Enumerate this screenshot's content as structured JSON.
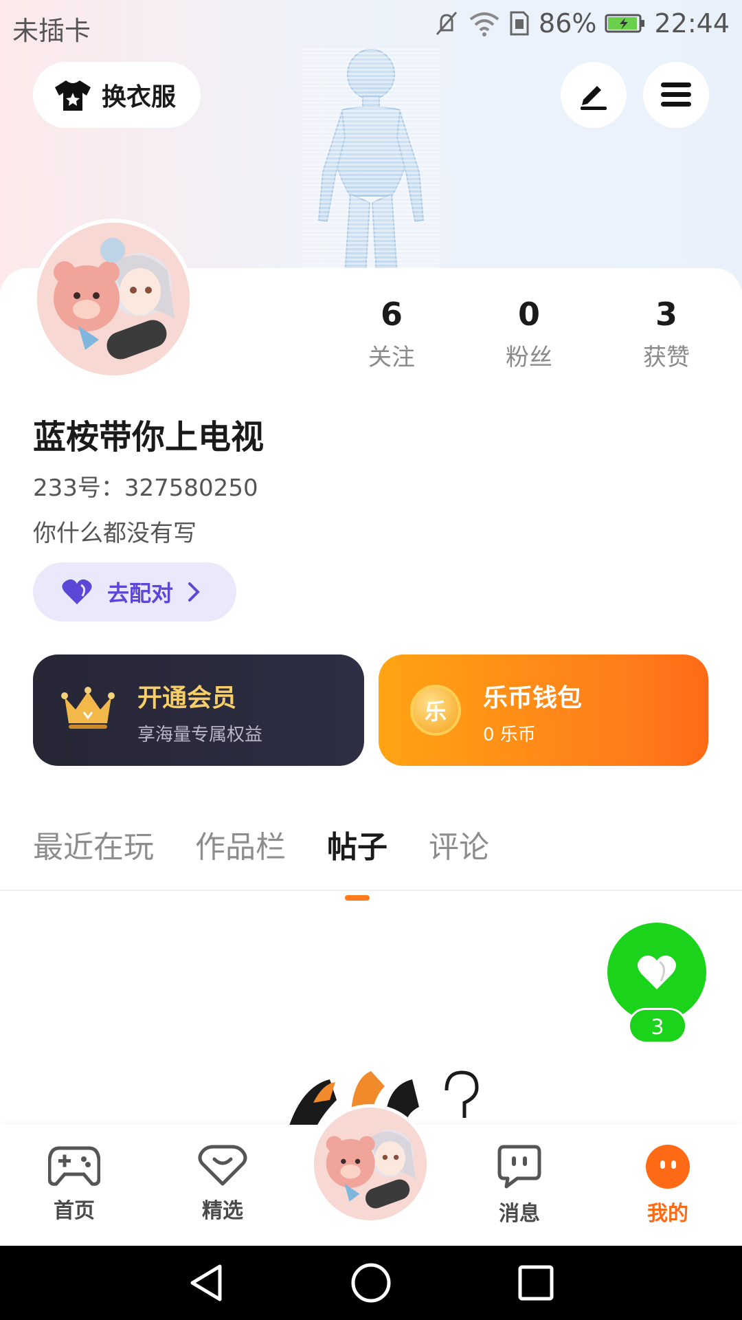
{
  "status_bar": {
    "carrier": "未插卡",
    "battery": "86%",
    "time": "22:44"
  },
  "header": {
    "outfit_label": "换衣服"
  },
  "profile": {
    "stats": [
      {
        "value": "6",
        "label": "关注"
      },
      {
        "value": "0",
        "label": "粉丝"
      },
      {
        "value": "3",
        "label": "获赞"
      }
    ],
    "username": "蓝桉带你上电视",
    "uid": "233号：327580250",
    "bio": "你什么都没有写",
    "match_label": "去配对"
  },
  "cards": {
    "vip_title": "开通会员",
    "vip_sub": "享海量专属权益",
    "wallet_title": "乐币钱包",
    "wallet_sub": "0 乐币",
    "coin_glyph": "乐"
  },
  "tabs": [
    {
      "label": "最近在玩",
      "active": false
    },
    {
      "label": "作品栏",
      "active": false
    },
    {
      "label": "帖子",
      "active": true
    },
    {
      "label": "评论",
      "active": false
    }
  ],
  "like": {
    "count": "3"
  },
  "bottom_nav": [
    {
      "label": "首页",
      "icon": "gamepad-icon"
    },
    {
      "label": "精选",
      "icon": "heart-chat-icon"
    },
    {
      "label": "消息",
      "icon": "message-icon"
    },
    {
      "label": "我的",
      "icon": "me-icon",
      "active": true
    }
  ],
  "colors": {
    "accent": "#ff7a1a",
    "match": "#5b48d6",
    "like": "#1bd31b"
  }
}
